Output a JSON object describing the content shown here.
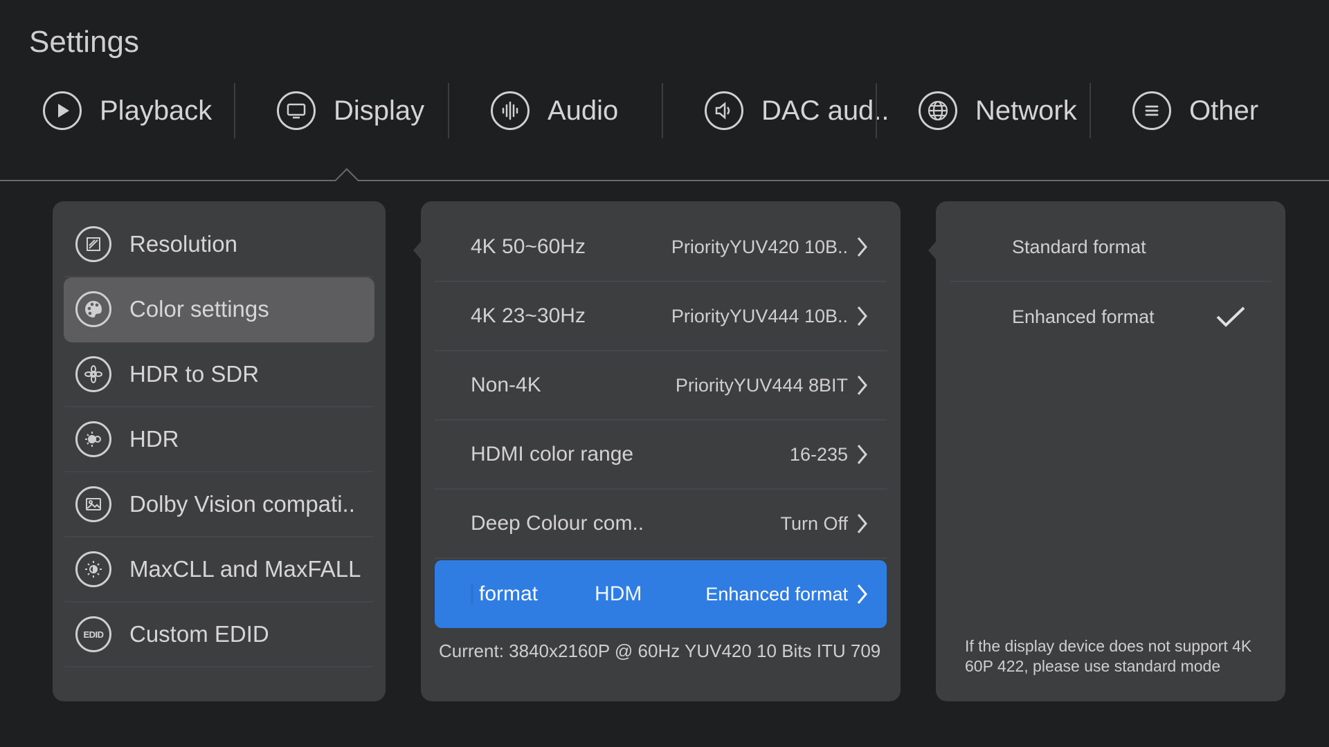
{
  "page_title": "Settings",
  "tabs": [
    {
      "label": "Playback",
      "icon": "play-icon"
    },
    {
      "label": "Display",
      "icon": "monitor-icon"
    },
    {
      "label": "Audio",
      "icon": "audio-waveform-icon"
    },
    {
      "label": "DAC aud..",
      "icon": "speaker-icon"
    },
    {
      "label": "Network",
      "icon": "globe-icon"
    },
    {
      "label": "Other",
      "icon": "menu-lines-icon"
    }
  ],
  "active_tab": "Display",
  "left_menu": [
    {
      "label": "Resolution",
      "icon": "resolution-icon"
    },
    {
      "label": "Color settings",
      "icon": "palette-icon"
    },
    {
      "label": "HDR to SDR",
      "icon": "aperture-icon"
    },
    {
      "label": "HDR",
      "icon": "hdr-sun-icon"
    },
    {
      "label": "Dolby Vision compati..",
      "icon": "picture-icon"
    },
    {
      "label": "MaxCLL and MaxFALL",
      "icon": "brightness-icon"
    },
    {
      "label": "Custom EDID",
      "icon": "edid-icon",
      "icon_text": "EDID"
    }
  ],
  "active_left_item": "Color settings",
  "color_rows": [
    {
      "label": "4K 50~60Hz",
      "value": "PriorityYUV420 10B.."
    },
    {
      "label": "4K 23~30Hz",
      "value": "PriorityYUV444 10B.."
    },
    {
      "label": "Non-4K",
      "value": "PriorityYUV444 8BIT"
    },
    {
      "label": "HDMI color range",
      "value": "16-235"
    },
    {
      "label": "Deep Colour com..",
      "value": "Turn Off"
    }
  ],
  "selected_row": {
    "label_part1": "format",
    "label_part2": "HDM",
    "value": "Enhanced format"
  },
  "current_info": "Current: 3840x2160P @ 60Hz  YUV420  10 Bits  ITU 709",
  "format_options": [
    {
      "label": "Standard format",
      "checked": false
    },
    {
      "label": "Enhanced format",
      "checked": true
    }
  ],
  "hint": "If the display device does not support 4K 60P 422, please use standard mode",
  "colors": {
    "background": "#1e1f21",
    "panel": "#3d3e40",
    "active_item": "#5d5d5f",
    "selected_accent": "#2f7ce3"
  }
}
